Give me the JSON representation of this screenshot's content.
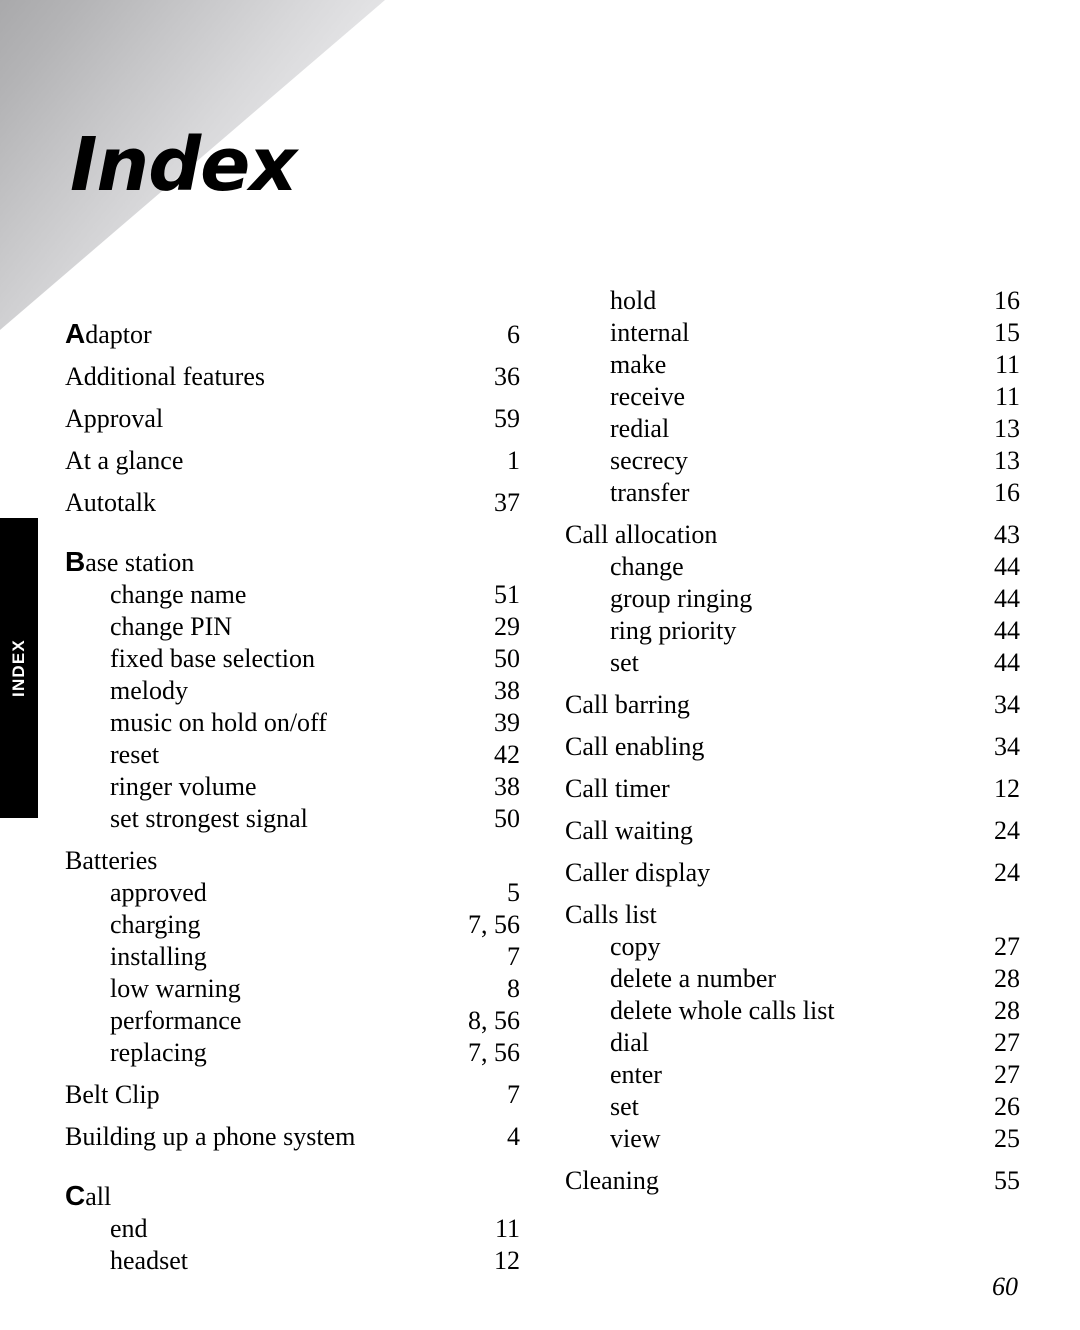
{
  "page": {
    "title": "Index",
    "folio": "60",
    "side_tab_label": "INDEX"
  },
  "columns": {
    "left": [
      {
        "letter": "A",
        "label": "daptor",
        "page": "6",
        "level": "main",
        "letter_start": true,
        "first": true
      },
      {
        "label": "Additional features",
        "page": "36",
        "level": "main"
      },
      {
        "label": "Approval",
        "page": "59",
        "level": "main"
      },
      {
        "label": "At a glance",
        "page": "1",
        "level": "main"
      },
      {
        "label": "Autotalk",
        "page": "37",
        "level": "main"
      },
      {
        "letter": "B",
        "label": "ase station",
        "page": "",
        "level": "main",
        "letter_start": true
      },
      {
        "label": "change name",
        "page": "51",
        "level": "sub"
      },
      {
        "label": "change PIN",
        "page": "29",
        "level": "sub"
      },
      {
        "label": "fixed base selection",
        "page": "50",
        "level": "sub"
      },
      {
        "label": "melody",
        "page": "38",
        "level": "sub"
      },
      {
        "label": "music on hold on/off",
        "page": "39",
        "level": "sub"
      },
      {
        "label": "reset",
        "page": "42",
        "level": "sub"
      },
      {
        "label": "ringer volume",
        "page": "38",
        "level": "sub"
      },
      {
        "label": "set strongest signal",
        "page": "50",
        "level": "sub"
      },
      {
        "label": "Batteries",
        "page": "",
        "level": "main"
      },
      {
        "label": "approved",
        "page": "5",
        "level": "sub"
      },
      {
        "label": "charging",
        "page": "7, 56",
        "level": "sub"
      },
      {
        "label": "installing",
        "page": "7",
        "level": "sub"
      },
      {
        "label": "low warning",
        "page": "8",
        "level": "sub"
      },
      {
        "label": "performance",
        "page": "8, 56",
        "level": "sub"
      },
      {
        "label": "replacing",
        "page": "7, 56",
        "level": "sub"
      },
      {
        "label": "Belt Clip",
        "page": "7",
        "level": "main"
      },
      {
        "label": "Building up a phone system",
        "page": "4",
        "level": "main"
      },
      {
        "letter": "C",
        "label": "all",
        "page": "",
        "level": "main",
        "letter_start": true
      },
      {
        "label": "end",
        "page": "11",
        "level": "sub"
      },
      {
        "label": "headset",
        "page": "12",
        "level": "sub"
      }
    ],
    "right": [
      {
        "label": "hold",
        "page": "16",
        "level": "sub",
        "first": true
      },
      {
        "label": "internal",
        "page": "15",
        "level": "sub"
      },
      {
        "label": "make",
        "page": "11",
        "level": "sub"
      },
      {
        "label": "receive",
        "page": "11",
        "level": "sub"
      },
      {
        "label": "redial",
        "page": "13",
        "level": "sub"
      },
      {
        "label": "secrecy",
        "page": "13",
        "level": "sub"
      },
      {
        "label": "transfer",
        "page": "16",
        "level": "sub"
      },
      {
        "label": "Call allocation",
        "page": "43",
        "level": "main"
      },
      {
        "label": "change",
        "page": "44",
        "level": "sub"
      },
      {
        "label": "group ringing",
        "page": "44",
        "level": "sub"
      },
      {
        "label": "ring priority",
        "page": "44",
        "level": "sub"
      },
      {
        "label": "set",
        "page": "44",
        "level": "sub"
      },
      {
        "label": "Call barring",
        "page": "34",
        "level": "main"
      },
      {
        "label": "Call enabling",
        "page": "34",
        "level": "main"
      },
      {
        "label": "Call timer",
        "page": "12",
        "level": "main"
      },
      {
        "label": "Call waiting",
        "page": "24",
        "level": "main"
      },
      {
        "label": "Caller display",
        "page": "24",
        "level": "main"
      },
      {
        "label": "Calls list",
        "page": "",
        "level": "main"
      },
      {
        "label": "copy",
        "page": "27",
        "level": "sub"
      },
      {
        "label": "delete a number",
        "page": "28",
        "level": "sub"
      },
      {
        "label": "delete whole calls list",
        "page": "28",
        "level": "sub"
      },
      {
        "label": "dial",
        "page": "27",
        "level": "sub"
      },
      {
        "label": "enter",
        "page": "27",
        "level": "sub"
      },
      {
        "label": "set",
        "page": "26",
        "level": "sub"
      },
      {
        "label": "view",
        "page": "25",
        "level": "sub"
      },
      {
        "label": "Cleaning",
        "page": "55",
        "level": "main"
      }
    ]
  }
}
